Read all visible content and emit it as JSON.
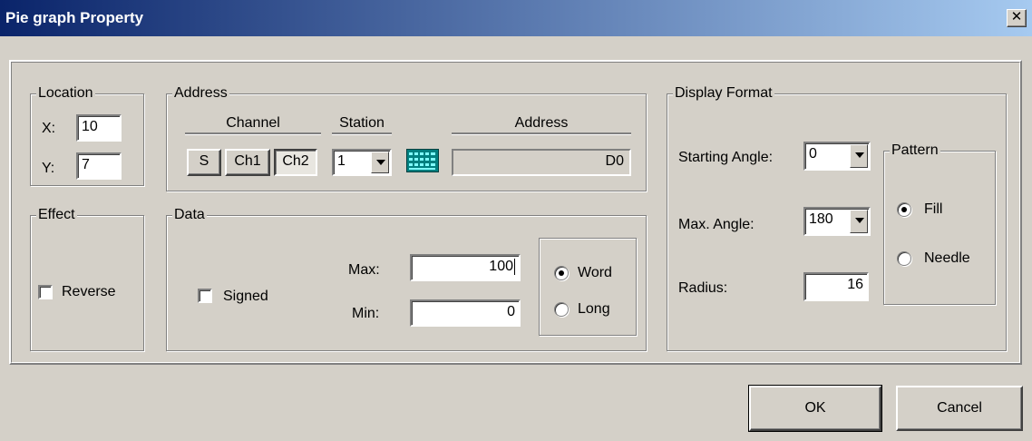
{
  "window": {
    "title": "Pie graph Property",
    "close_label": "✕"
  },
  "location": {
    "legend": "Location",
    "x_label": "X:",
    "x_value": "10",
    "y_label": "Y:",
    "y_value": "7"
  },
  "address": {
    "legend": "Address",
    "channel_header": "Channel",
    "station_header": "Station",
    "address_header": "Address",
    "channel_buttons": [
      "S",
      "Ch1",
      "Ch2"
    ],
    "channel_selected": "Ch2",
    "station_value": "1",
    "address_value": "D0",
    "keypad_icon": "keypad-icon"
  },
  "effect": {
    "legend": "Effect",
    "reverse_label": "Reverse",
    "reverse_checked": false
  },
  "data": {
    "legend": "Data",
    "signed_label": "Signed",
    "signed_checked": false,
    "max_label": "Max:",
    "max_value": "100",
    "min_label": "Min:",
    "min_value": "0",
    "word_label": "Word",
    "long_label": "Long",
    "size_selected": "Word"
  },
  "display_format": {
    "legend": "Display Format",
    "starting_angle_label": "Starting Angle:",
    "starting_angle_value": "0",
    "max_angle_label": "Max. Angle:",
    "max_angle_value": "180",
    "radius_label": "Radius:",
    "radius_value": "16"
  },
  "pattern": {
    "legend": "Pattern",
    "fill_label": "Fill",
    "needle_label": "Needle",
    "selected": "Fill"
  },
  "footer": {
    "ok_label": "OK",
    "cancel_label": "Cancel"
  }
}
